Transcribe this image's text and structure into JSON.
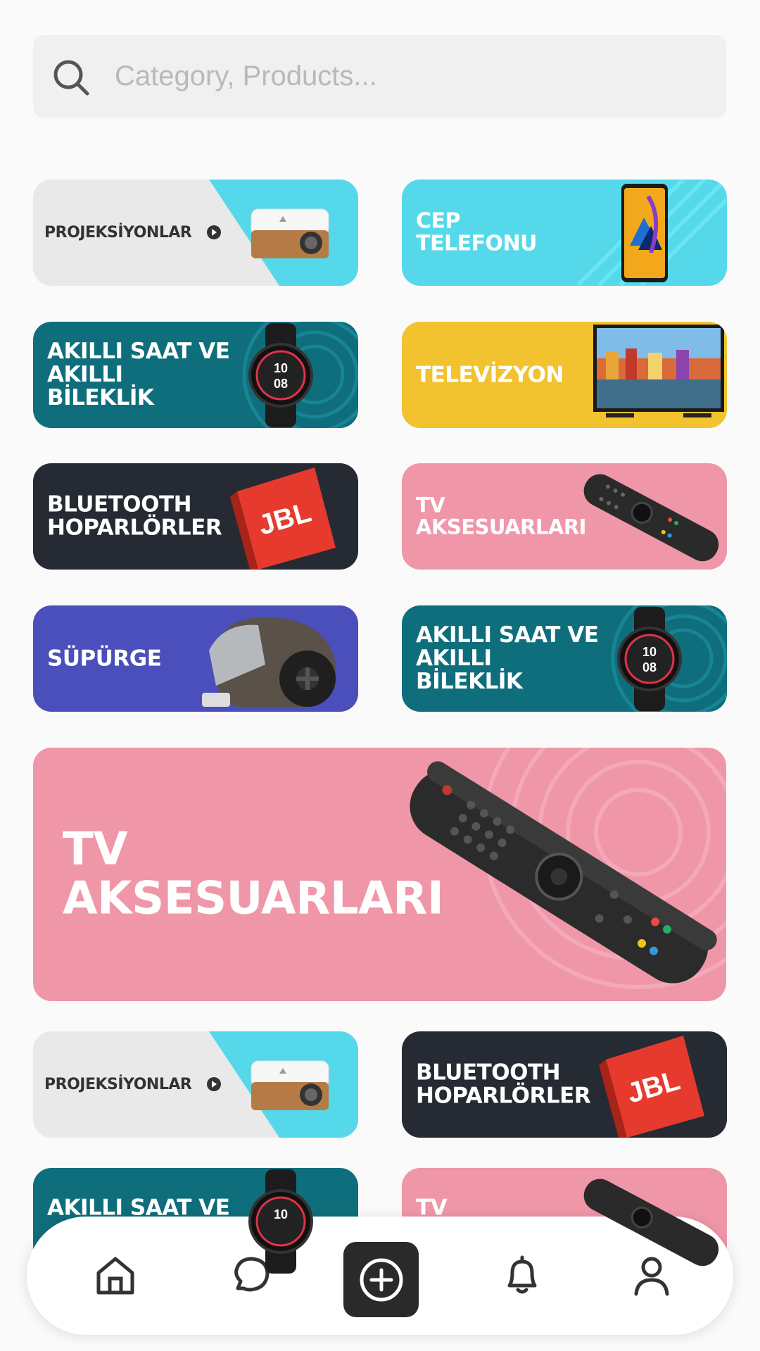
{
  "search": {
    "placeholder": "Category, Products..."
  },
  "banners": [
    {
      "label": "PROJEKSİYONLAR",
      "bg": "#e9e9e9",
      "accent": "#55d9ea",
      "text_color": "#333333",
      "product": "projector-image"
    },
    {
      "label": "CEP\nTELEFONU",
      "bg": "#55d9ea",
      "text_color": "#ffffff",
      "product": "phone-image"
    },
    {
      "label": "AKILLI SAAT VE\nAKILLI BİLEKLİK",
      "bg": "#0f6e7b",
      "text_color": "#ffffff",
      "product": "smartwatch-image"
    },
    {
      "label": "TELEVİZYON",
      "bg": "#f2c22f",
      "text_color": "#ffffff",
      "product": "tv-image"
    },
    {
      "label": "BLUETOOTH\nHOPARLÖRLER",
      "bg": "#262b33",
      "text_color": "#ffffff",
      "product": "speaker-image",
      "brand": "JBL"
    },
    {
      "label": "TV\nAKSESUARLARI",
      "bg": "#ef97a8",
      "text_color": "#ffffff",
      "product": "remote-image"
    },
    {
      "label": "SÜPÜRGE",
      "bg": "#4b4fbb",
      "text_color": "#ffffff",
      "product": "vacuum-image"
    },
    {
      "label": "AKILLI SAAT VE\nAKILLI BİLEKLİK",
      "bg": "#0f6e7b",
      "text_color": "#ffffff",
      "product": "smartwatch-image"
    },
    {
      "label": "TV\nAKSESUARLARI",
      "bg": "#ef97a8",
      "text_color": "#ffffff",
      "product": "remote-image"
    },
    {
      "label": "PROJEKSİYONLAR",
      "bg": "#e9e9e9",
      "accent": "#55d9ea",
      "text_color": "#333333",
      "product": "projector-image"
    },
    {
      "label": "BLUETOOTH\nHOPARLÖRLER",
      "bg": "#262b33",
      "text_color": "#ffffff",
      "product": "speaker-image",
      "brand": "JBL"
    },
    {
      "label": "AKILLI SAAT VE",
      "bg": "#0f6e7b",
      "text_color": "#ffffff",
      "product": "smartwatch-image"
    },
    {
      "label": "TV",
      "bg": "#ef97a8",
      "text_color": "#ffffff",
      "product": "remote-image"
    }
  ],
  "watch_face": {
    "line1": "10",
    "line2": "08"
  },
  "bottom_nav": {
    "items": [
      {
        "icon": "home-icon"
      },
      {
        "icon": "chat-icon"
      },
      {
        "icon": "add-icon"
      },
      {
        "icon": "bell-icon"
      },
      {
        "icon": "profile-icon"
      }
    ]
  }
}
